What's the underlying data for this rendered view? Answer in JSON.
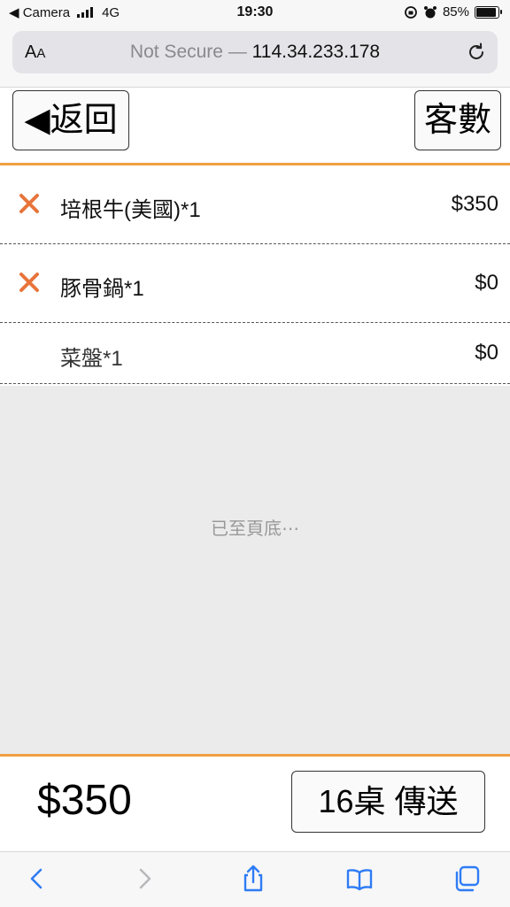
{
  "status_bar": {
    "back_app": "◀ Camera",
    "network": "4G",
    "time": "19:30",
    "battery": "85%",
    "battery_level": 0.85
  },
  "address_bar": {
    "aa": "AA",
    "security": "Not Secure",
    "separator": " — ",
    "host": "114.34.233.178"
  },
  "header": {
    "back_label": "◀返回",
    "guests_label": "客數"
  },
  "order_items": [
    {
      "name": "培根牛(美國)*1",
      "price": "$350",
      "removable": true
    },
    {
      "name": "豚骨鍋*1",
      "price": "$0",
      "removable": true
    },
    {
      "name": "菜盤*1",
      "price": "$0",
      "removable": false
    }
  ],
  "end_message": "已至頁底⋯",
  "footer": {
    "total": "$350",
    "send_label": "16桌 傳送"
  },
  "colors": {
    "accent": "#f0a040",
    "remove": "#e8743b",
    "ios_blue": "#2f7cf6"
  },
  "icons": {
    "remove": "close-x-icon",
    "reload": "reload-icon",
    "back": "chevron-left-icon",
    "forward": "chevron-right-icon",
    "share": "share-icon",
    "bookmarks": "book-icon",
    "tabs": "tabs-icon"
  }
}
